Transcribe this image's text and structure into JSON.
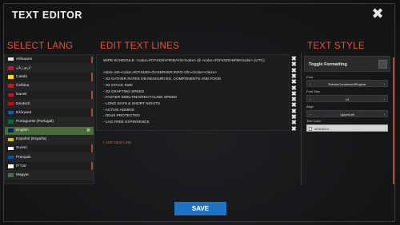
{
  "title": "TEXT EDITOR",
  "sections": {
    "select_lang": "SELECT LANG",
    "edit_text_lines": "EDIT TEXT LINES",
    "text_style": "TEXT STYLE"
  },
  "languages": [
    {
      "label": "Afrikaans",
      "flag": "#e8e8e8"
    },
    {
      "label": "اردو زبان",
      "flag": "#ce1126"
    },
    {
      "label": "Català",
      "flag": "#fcdd09"
    },
    {
      "label": "Čeština",
      "flag": "#d7141a"
    },
    {
      "label": "Dansk",
      "flag": "#c60c30"
    },
    {
      "label": "Deutsch",
      "flag": "#dd0000"
    },
    {
      "label": "Ελληνικά",
      "flag": "#0d5eaf"
    },
    {
      "label": "Portuguese (Portugal)",
      "flag": "#046a38"
    },
    {
      "label": "English",
      "flag": "#012169",
      "selected": true
    },
    {
      "label": "Español (España)",
      "flag": "#f1bf00"
    },
    {
      "label": "Suomi",
      "flag": "#ffffff"
    },
    {
      "label": "Français",
      "flag": "#0055a4"
    },
    {
      "label": "עברית",
      "flag": "#ffffff"
    },
    {
      "label": "Magyar",
      "flag": "#436f4d"
    }
  ],
  "text_lines": [
    "WIPE SCHEDULE: <color=#CF4320>FRIDAYS</color> @ <color=#CF4320>6PM</color> (UTC)",
    "",
    "<size=18><color=#CF4320><b>SERVER INFO:</b></color></size>",
    "- X2 GATHER RATES ON RESOURCES, COMPONENTS AND FOOD",
    "- X2 STACK SIZE",
    "- X2 CRAFTING SPEED",
    "- FASTER SMELTING/RECYCLING SPEED",
    "- LONG DAYS & SHORT NIGHTS",
    "- ACTIVE ADMINS",
    "- DDoS PROTECTED",
    "- LAG FREE EXPERIENCE"
  ],
  "add_new_line": "+ ADD NEW LINE",
  "style": {
    "toggle_label": "Toggle Formatting",
    "font_label": "Font",
    "font_value": "RobotoCondensedRegular",
    "font_size_label": "Font Size",
    "font_size_value": "14",
    "align_label": "Align",
    "align_value": "UpperLeft",
    "text_color_label": "Text Color",
    "text_color_value": "#E3DBD3"
  },
  "icons": {
    "close": "✖",
    "arrow_left": "‹",
    "arrow_right": "›"
  },
  "save_label": "SAVE",
  "colors": {
    "accent": "#e2563a",
    "save": "#1f73c4",
    "selected_row": "#4a6b3a"
  }
}
